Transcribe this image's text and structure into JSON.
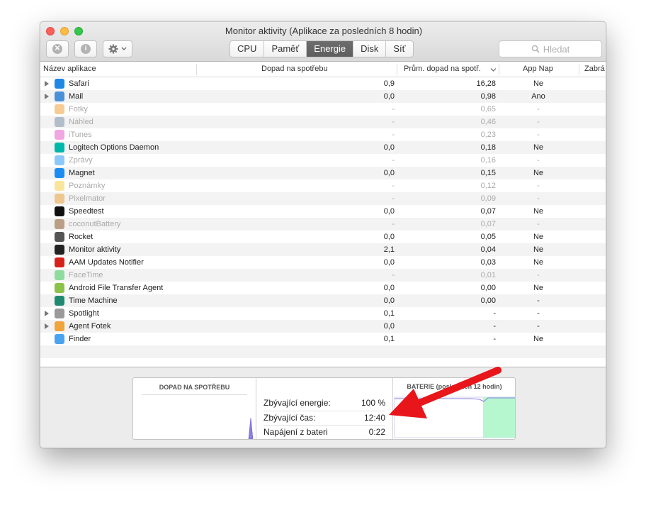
{
  "window": {
    "title": "Monitor aktivity (Aplikace za posledních 8 hodin)"
  },
  "toolbar": {
    "tabs": [
      {
        "label": "CPU",
        "active": false
      },
      {
        "label": "Paměť",
        "active": false
      },
      {
        "label": "Energie",
        "active": true
      },
      {
        "label": "Disk",
        "active": false
      },
      {
        "label": "Síť",
        "active": false
      }
    ],
    "search_placeholder": "Hledat"
  },
  "columns": {
    "name": "Název aplikace",
    "impact": "Dopad na spotřebu",
    "avg": "Prům. dopad na spotř.",
    "app_nap": "App Nap",
    "preventing_sleep": "Zabrá"
  },
  "rows": [
    {
      "name": "Safari",
      "impact": "0,9",
      "avg": "16,28",
      "app_nap": "Ne",
      "expandable": true,
      "dim": false,
      "icon": "safari-icon",
      "color": "#1e88e5"
    },
    {
      "name": "Mail",
      "impact": "0,0",
      "avg": "0,98",
      "app_nap": "Ano",
      "expandable": true,
      "dim": false,
      "icon": "mail-icon",
      "color": "#4a90d9"
    },
    {
      "name": "Fotky",
      "impact": "-",
      "avg": "0,65",
      "app_nap": "-",
      "expandable": false,
      "dim": true,
      "icon": "photos-icon",
      "color": "#f1a33c"
    },
    {
      "name": "Náhled",
      "impact": "-",
      "avg": "0,46",
      "app_nap": "-",
      "expandable": false,
      "dim": true,
      "icon": "preview-icon",
      "color": "#7a8fa6"
    },
    {
      "name": "iTunes",
      "impact": "-",
      "avg": "0,23",
      "app_nap": "-",
      "expandable": false,
      "dim": true,
      "icon": "itunes-icon",
      "color": "#e35fc9"
    },
    {
      "name": "Logitech Options Daemon",
      "impact": "0,0",
      "avg": "0,18",
      "app_nap": "Ne",
      "expandable": false,
      "dim": false,
      "icon": "logitech-icon",
      "color": "#00b8a9"
    },
    {
      "name": "Zprávy",
      "impact": "-",
      "avg": "0,16",
      "app_nap": "-",
      "expandable": false,
      "dim": true,
      "icon": "messages-icon",
      "color": "#2f9af6"
    },
    {
      "name": "Magnet",
      "impact": "0,0",
      "avg": "0,15",
      "app_nap": "Ne",
      "expandable": false,
      "dim": false,
      "icon": "magnet-icon",
      "color": "#1b8df2"
    },
    {
      "name": "Poznámky",
      "impact": "-",
      "avg": "0,12",
      "app_nap": "-",
      "expandable": false,
      "dim": true,
      "icon": "notes-icon",
      "color": "#f5cf4d"
    },
    {
      "name": "Pixelmator",
      "impact": "-",
      "avg": "0,09",
      "app_nap": "-",
      "expandable": false,
      "dim": true,
      "icon": "pixelmator-icon",
      "color": "#e8a33a"
    },
    {
      "name": "Speedtest",
      "impact": "0,0",
      "avg": "0,07",
      "app_nap": "Ne",
      "expandable": false,
      "dim": false,
      "icon": "speedtest-icon",
      "color": "#111111"
    },
    {
      "name": "coconutBattery",
      "impact": "-",
      "avg": "0,07",
      "app_nap": "-",
      "expandable": false,
      "dim": true,
      "icon": "coconut-icon",
      "color": "#8b5a2b"
    },
    {
      "name": "Rocket",
      "impact": "0,0",
      "avg": "0,05",
      "app_nap": "Ne",
      "expandable": false,
      "dim": false,
      "icon": "rocket-icon",
      "color": "#555555"
    },
    {
      "name": "Monitor aktivity",
      "impact": "2,1",
      "avg": "0,04",
      "app_nap": "Ne",
      "expandable": false,
      "dim": false,
      "icon": "activity-monitor-icon",
      "color": "#222222"
    },
    {
      "name": "AAM Updates Notifier",
      "impact": "0,0",
      "avg": "0,03",
      "app_nap": "Ne",
      "expandable": false,
      "dim": false,
      "icon": "adobe-icon",
      "color": "#d6221b"
    },
    {
      "name": "FaceTime",
      "impact": "-",
      "avg": "0,01",
      "app_nap": "-",
      "expandable": false,
      "dim": true,
      "icon": "facetime-icon",
      "color": "#3cc85a"
    },
    {
      "name": "Android File Transfer Agent",
      "impact": "0,0",
      "avg": "0,00",
      "app_nap": "Ne",
      "expandable": false,
      "dim": false,
      "icon": "android-icon",
      "color": "#8bc34a"
    },
    {
      "name": "Time Machine",
      "impact": "0,0",
      "avg": "0,00",
      "app_nap": "-",
      "expandable": false,
      "dim": false,
      "icon": "time-machine-icon",
      "color": "#1f8a70"
    },
    {
      "name": "Spotlight",
      "impact": "0,1",
      "avg": "-",
      "app_nap": "-",
      "expandable": true,
      "dim": false,
      "icon": "spotlight-icon",
      "color": "#9a9a9a"
    },
    {
      "name": "Agent Fotek",
      "impact": "0,0",
      "avg": "-",
      "app_nap": "-",
      "expandable": true,
      "dim": false,
      "icon": "photos-agent-icon",
      "color": "#f1a33c"
    },
    {
      "name": "Finder",
      "impact": "0,1",
      "avg": "-",
      "app_nap": "Ne",
      "expandable": false,
      "dim": false,
      "icon": "finder-icon",
      "color": "#4aa3f0"
    }
  ],
  "bottom": {
    "left_title": "DOPAD NA SPOTŘEBU",
    "stats": [
      {
        "label": "Zbývající energie:",
        "value": "100 %"
      },
      {
        "label": "Zbývající čas:",
        "value": "12:40"
      },
      {
        "label": "Napájení z bateri",
        "value": "0:22"
      }
    ],
    "right_title": "BATERIE (posledních 12 hodin)",
    "battery_level": 1.0
  },
  "colors": {
    "accent": "#5e5e5e",
    "graph_line": "#8a7de3",
    "graph_fill": "#b7f7d0",
    "annotation_arrow": "#e8151b"
  }
}
